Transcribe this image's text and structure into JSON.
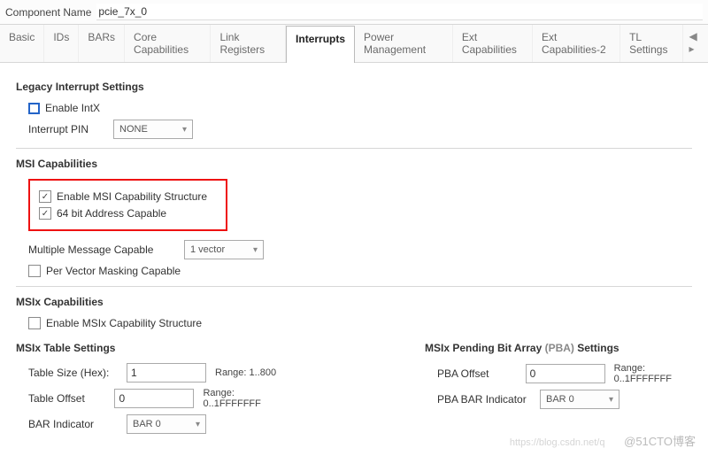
{
  "header": {
    "label": "Component Name",
    "value": "pcie_7x_0"
  },
  "tabs": {
    "items": [
      "Basic",
      "IDs",
      "BARs",
      "Core Capabilities",
      "Link Registers",
      "Interrupts",
      "Power Management",
      "Ext Capabilities",
      "Ext Capabilities-2",
      "TL Settings"
    ],
    "active_index": 5
  },
  "legacy": {
    "title": "Legacy Interrupt Settings",
    "enable_intx": "Enable IntX",
    "interrupt_pin_label": "Interrupt PIN",
    "interrupt_pin_value": "NONE"
  },
  "msi": {
    "title": "MSI Capabilities",
    "enable_cap": "Enable MSI Capability Structure",
    "addr_64": "64 bit Address Capable",
    "multi_label": "Multiple Message Capable",
    "multi_value": "1 vector",
    "per_vector": "Per Vector Masking Capable"
  },
  "msix": {
    "title": "MSIx Capabilities",
    "enable_cap": "Enable MSIx Capability Structure"
  },
  "msix_table": {
    "title": "MSIx Table Settings",
    "table_size_label": "Table Size (Hex):",
    "table_size_value": "1",
    "table_size_range": "Range: 1..800",
    "table_offset_label": "Table Offset",
    "table_offset_value": "0",
    "table_offset_range": "Range: 0..1FFFFFFF",
    "bar_ind_label": "BAR Indicator",
    "bar_ind_value": "BAR 0"
  },
  "msix_pba": {
    "title_prefix": "MSIx Pending Bit Array ",
    "title_paren": "(PBA)",
    "title_suffix": " Settings",
    "pba_offset_label": "PBA Offset",
    "pba_offset_value": "0",
    "pba_offset_range": "Range: 0..1FFFFFFF",
    "pba_bar_label": "PBA BAR Indicator",
    "pba_bar_value": "BAR 0"
  },
  "watermark": {
    "faint": "https://blog.csdn.net/q",
    "main": "@51CTO博客"
  }
}
